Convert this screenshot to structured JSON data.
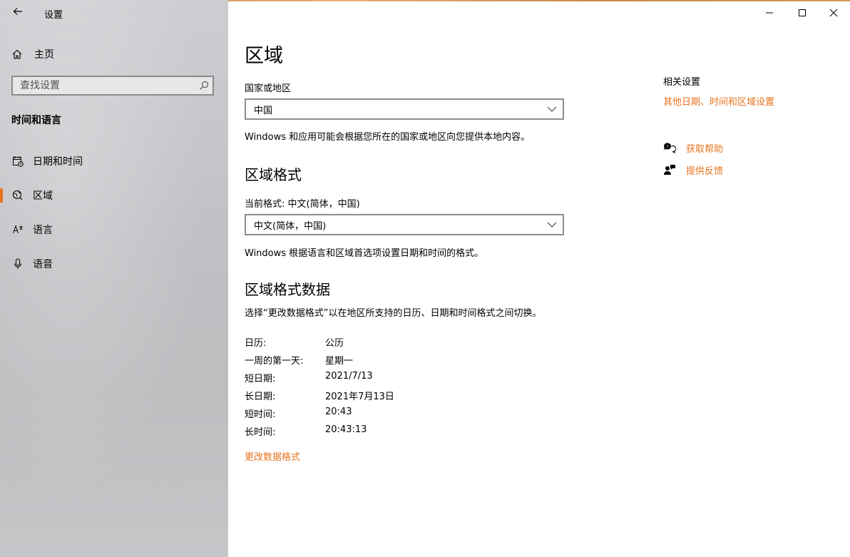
{
  "window": {
    "title": "设置",
    "controls": {
      "minimize": "minimize",
      "maximize": "maximize",
      "close": "close"
    }
  },
  "sidebar": {
    "home_label": "主页",
    "search_placeholder": "查找设置",
    "section_title": "时间和语言",
    "items": [
      {
        "label": "日期和时间",
        "icon": "calendar-clock-icon",
        "active": false
      },
      {
        "label": "区域",
        "icon": "globe-icon",
        "active": true
      },
      {
        "label": "语言",
        "icon": "language-icon",
        "active": false
      },
      {
        "label": "语音",
        "icon": "microphone-icon",
        "active": false
      }
    ]
  },
  "main": {
    "title": "区域",
    "country_label": "国家或地区",
    "country_value": "中国",
    "country_desc": "Windows 和应用可能会根据您所在的国家或地区向您提供本地内容。",
    "format_heading": "区域格式",
    "format_current_label": "当前格式: 中文(简体，中国)",
    "format_value": "中文(简体，中国)",
    "format_desc": "Windows 根据语言和区域首选项设置日期和时间的格式。",
    "data_heading": "区域格式数据",
    "data_desc": "选择“更改数据格式”以在地区所支持的日历、日期和时间格式之间切换。",
    "data_rows": [
      {
        "key": "日历:",
        "value": "公历"
      },
      {
        "key": "一周的第一天:",
        "value": "星期一"
      },
      {
        "key": "短日期:",
        "value": "2021/7/13"
      },
      {
        "key": "长日期:",
        "value": "2021年7月13日"
      },
      {
        "key": "短时间:",
        "value": "20:43"
      },
      {
        "key": "长时间:",
        "value": "20:43:13"
      }
    ],
    "change_link": "更改数据格式"
  },
  "related": {
    "title": "相关设置",
    "link": "其他日期、时间和区域设置",
    "help_label": "获取帮助",
    "feedback_label": "提供反馈"
  },
  "colors": {
    "accent": "#e8731e"
  }
}
